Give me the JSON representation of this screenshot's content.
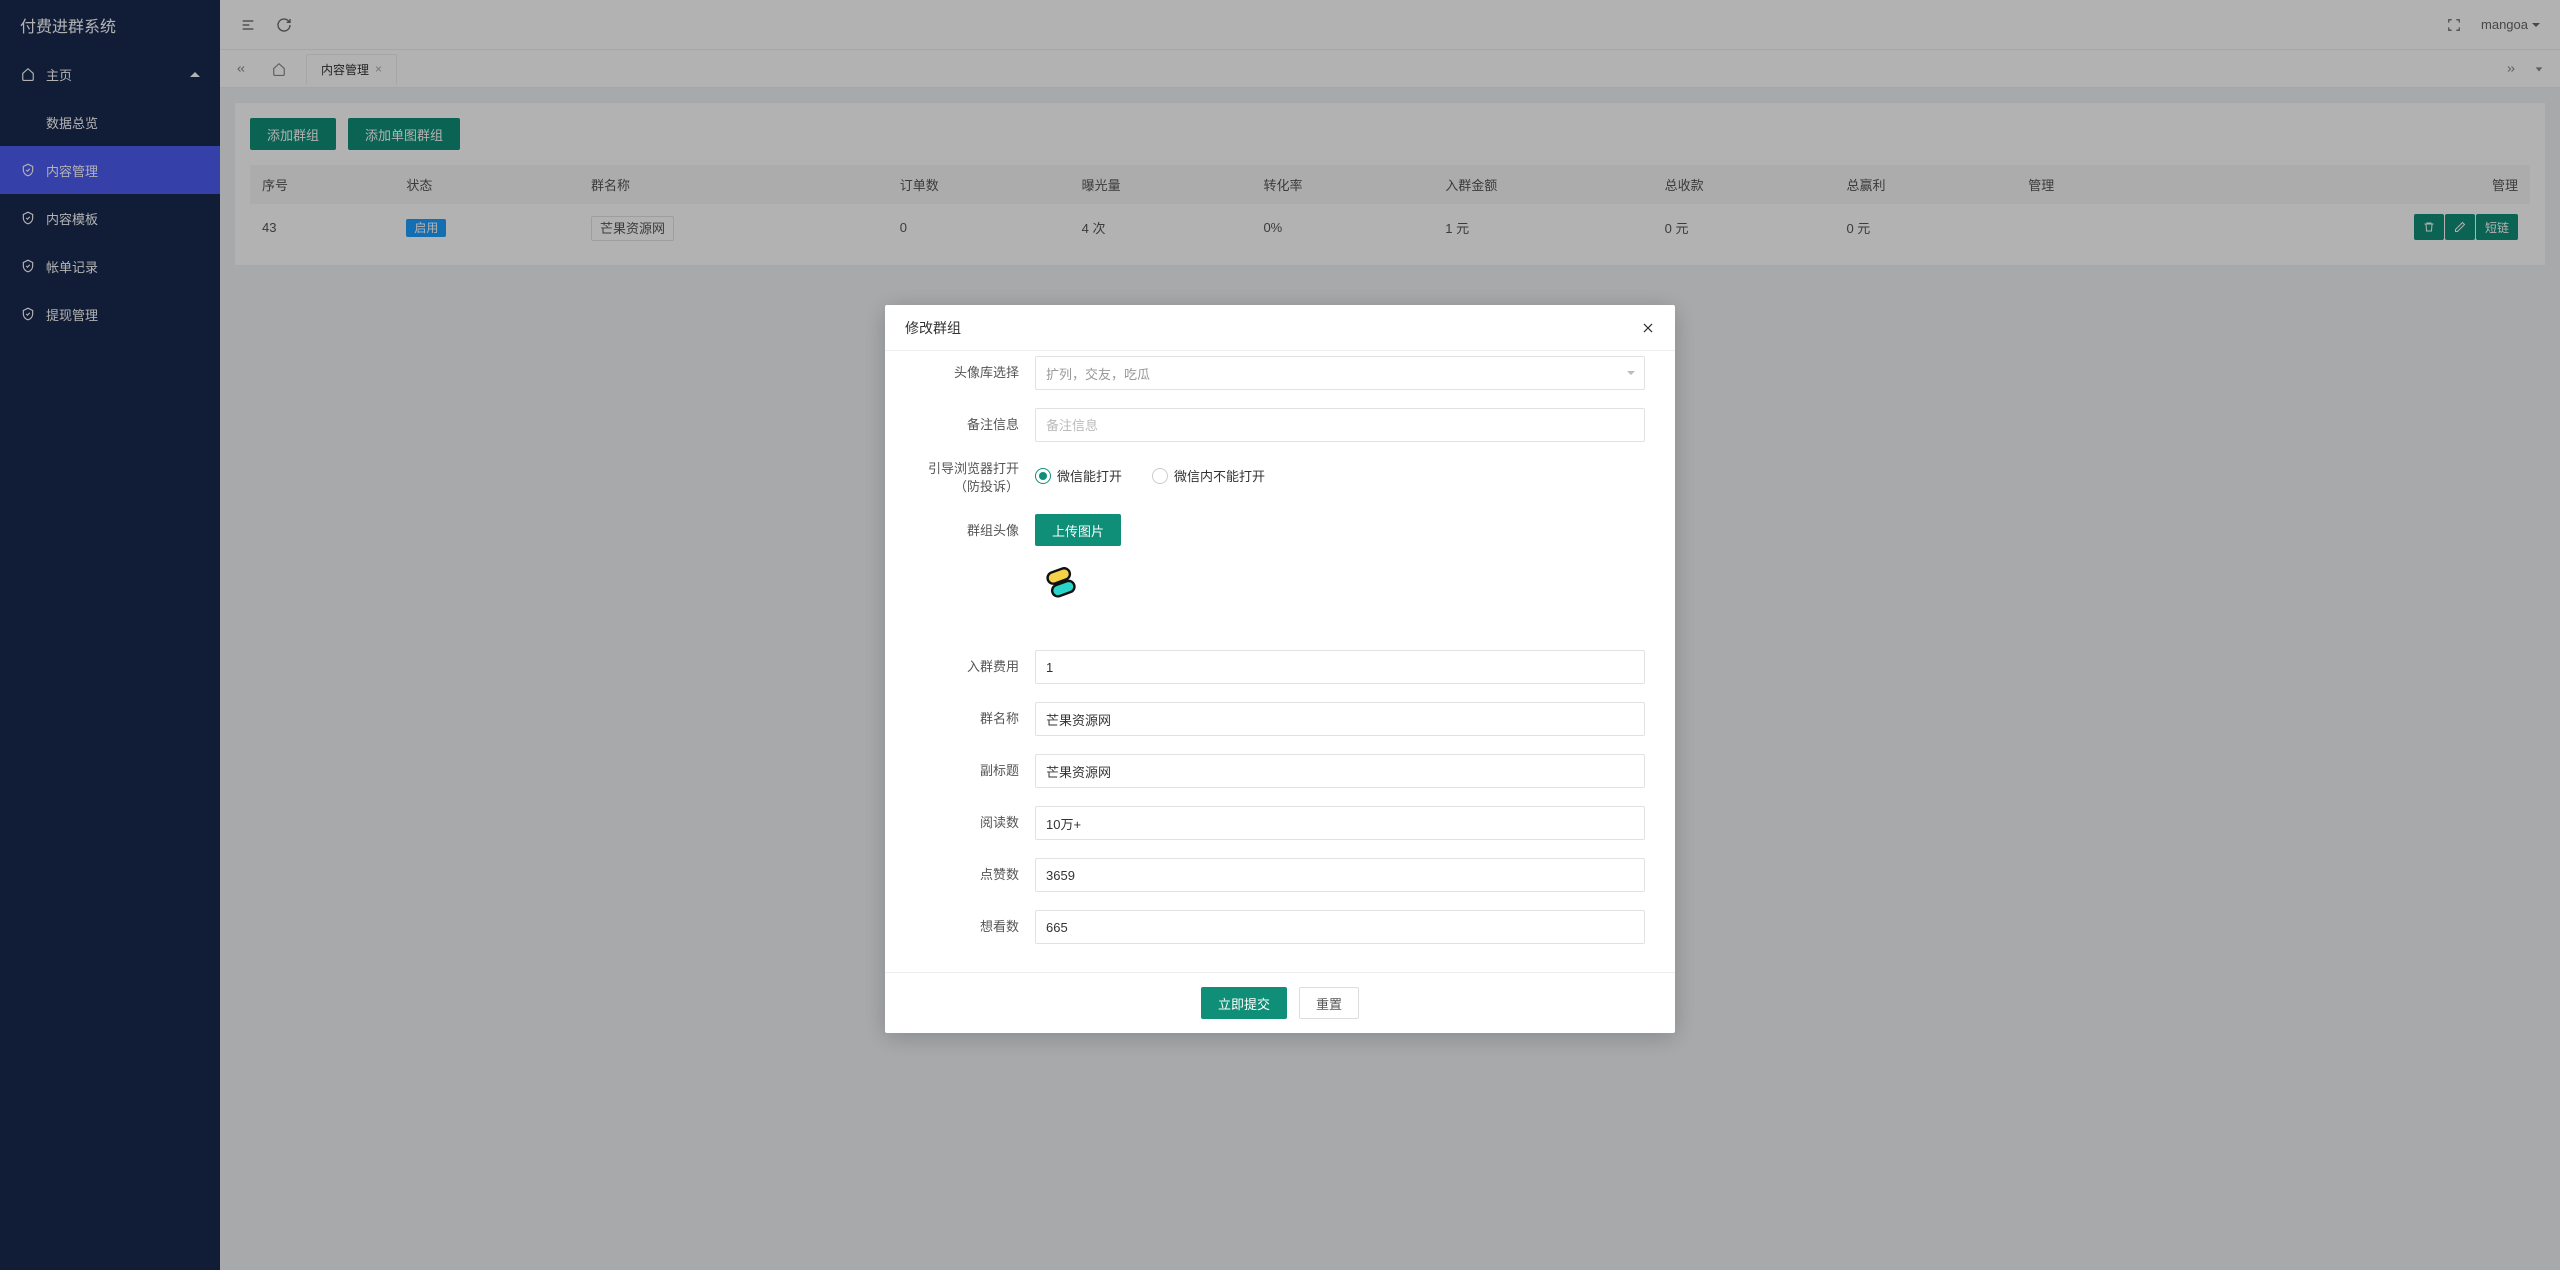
{
  "app_title": "付费进群系统",
  "user_name": "mangoa",
  "sidebar": {
    "main": "主页",
    "items": [
      {
        "label": "数据总览"
      },
      {
        "label": "内容管理"
      },
      {
        "label": "内容模板"
      },
      {
        "label": "帐单记录"
      },
      {
        "label": "提现管理"
      }
    ]
  },
  "tabs": {
    "content_mgmt": "内容管理"
  },
  "buttons": {
    "add_group": "添加群组",
    "add_single_image_group": "添加单图群组",
    "upload_image": "上传图片",
    "submit": "立即提交",
    "reset": "重置",
    "short_link": "短链"
  },
  "table": {
    "headers": {
      "seq": "序号",
      "status": "状态",
      "name": "群名称",
      "orders": "订单数",
      "exposure": "曝光量",
      "conversion": "转化率",
      "amount": "入群金额",
      "total_income": "总收款",
      "total_profit": "总赢利",
      "manage1": "管理",
      "manage2": "管理"
    },
    "rows": [
      {
        "seq": "43",
        "status": "启用",
        "name": "芒果资源网",
        "orders": "0",
        "exposure": "4 次",
        "conversion": "0%",
        "amount": "1 元",
        "total_income": "0 元",
        "total_profit": "0 元"
      }
    ]
  },
  "dialog": {
    "title": "修改群组",
    "labels": {
      "avatar_lib": "头像库选择",
      "remark": "备注信息",
      "browser_guide": "引导浏览器打开（防投诉）",
      "group_avatar": "群组头像",
      "join_fee": "入群费用",
      "group_name": "群名称",
      "subtitle": "副标题",
      "read_count": "阅读数",
      "like_count": "点赞数",
      "want_count": "想看数"
    },
    "values": {
      "avatar_lib": "扩列，交友，吃瓜",
      "remark_placeholder": "备注信息",
      "radio_wechat_can": "微信能打开",
      "radio_wechat_cannot": "微信内不能打开",
      "join_fee": "1",
      "group_name": "芒果资源网",
      "subtitle": "芒果资源网",
      "read_count": "10万+",
      "like_count": "3659",
      "want_count": "665"
    }
  }
}
